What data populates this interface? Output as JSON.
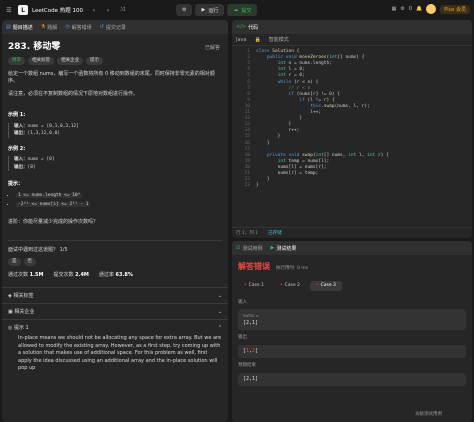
{
  "topbar": {
    "title": "LeetCode 热题 100",
    "run": "运行",
    "submit": "提交",
    "plus": "Plus 会员",
    "count": "0"
  },
  "left": {
    "tabs": [
      "题目描述",
      "题解",
      "解答错误",
      "提交记录"
    ],
    "number": "283. 移动零",
    "solved": "已解答",
    "chips": [
      "简单",
      "相关标签",
      "相关企业",
      "提示"
    ],
    "desc1": "给定一个数组 nums，编写一个函数将所有 0 移动到数组的末尾，同时保持非零元素的相对顺序。",
    "desc2": "请注意，必须在不复制数组的情况下原地对数组进行操作。",
    "ex1_h": "示例 1:",
    "ex1_in_l": "输入：",
    "ex1_in": "nums = [0,1,0,3,12]",
    "ex1_out_l": "输出：",
    "ex1_out": "[1,3,12,0,0]",
    "ex2_h": "示例 2:",
    "ex2_in_l": "输入：",
    "ex2_in": "nums = [0]",
    "ex2_out_l": "输出：",
    "ex2_out": "[0]",
    "hint_h": "提示：",
    "c1": "1 <= nums.length <= 10⁴",
    "c2": "-2³¹ <= nums[i] <= 2³¹ - 1",
    "followup": "进阶：你能尽量减少完成的操作次数吗？",
    "meet": "面试中遇到过这道题？",
    "meet_count": "1/5",
    "yes": "是",
    "no": "否",
    "pass_l": "通过次数",
    "pass_v": "1.5M",
    "sub_l": "提交次数",
    "sub_v": "2.4M",
    "rate_l": "通过率",
    "rate_v": "63.8%",
    "tags": "相关标签",
    "companies": "相关企业",
    "hint1": "提示 1",
    "hint_text": "In-place means we should not be allocating any space for extra array. But we are allowed to modify the existing array. However, as a first step, try coming up with a solution that makes use of additional space. For this problem as well, first apply the idea discussed using an additional array and the in-place solution will pop up"
  },
  "code": {
    "tab": "代码",
    "lang": "Java",
    "mode": "智能模式",
    "saved_pos": "行 1，列 1",
    "saved": "已存储",
    "lines": [
      "class Solution {",
      "    public void moveZeroes(int[] nums) {",
      "        int n = nums.length;",
      "        int l = 0;",
      "        int r = 0;",
      "        while (r < n) {",
      "            // r < n",
      "            if (nums[r] != 0) {",
      "                if (l != r) {",
      "                    this.swap(nums, l, r);",
      "                    l++;",
      "                }",
      "            }",
      "            r++;",
      "        }",
      "    }",
      "",
      "    private void swap(int[] nums, int l, int r) {",
      "        int temp = nums[l];",
      "        nums[l] = nums[r];",
      "        nums[r] = temp;",
      "    }",
      "}"
    ]
  },
  "test": {
    "tabs": [
      "测试用例",
      "测试结果"
    ],
    "status": "解答错误",
    "runtime": "执行用时: 0 ms",
    "cases": [
      "Case 1",
      "Case 2",
      "Case 3"
    ],
    "input_l": "输入",
    "var": "nums =",
    "input_v": "[2,1]",
    "output_l": "输出",
    "output_v": "[1,2]",
    "expected_l": "预期结果",
    "expected_v": "[2,1]",
    "contrib": "贡献测试用例"
  }
}
